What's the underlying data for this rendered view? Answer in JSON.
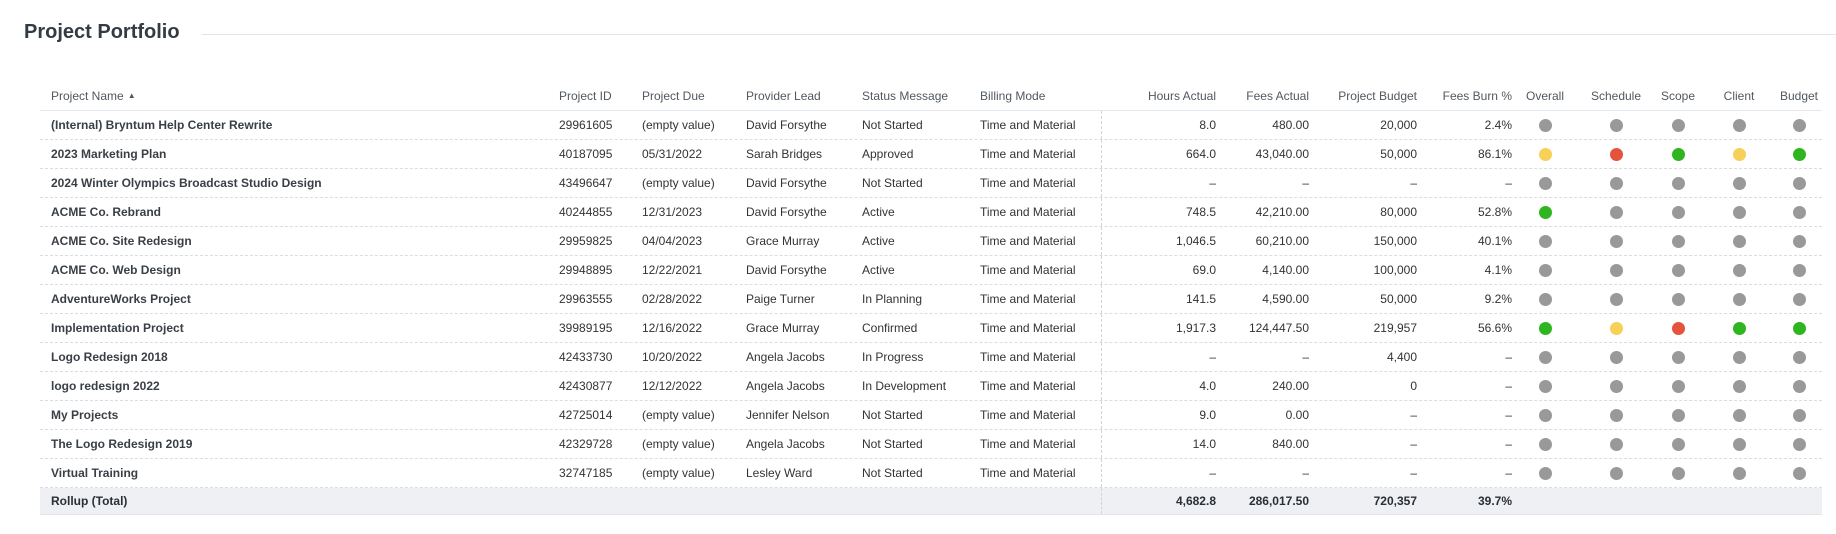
{
  "title": "Project Portfolio",
  "colors": {
    "grey": "#999999",
    "yellow": "#f6d057",
    "red": "#e5533d",
    "green": "#2fb520"
  },
  "columns": [
    {
      "key": "name",
      "label": "Project Name",
      "sorted": "asc",
      "sort_icon": "▲"
    },
    {
      "key": "id",
      "label": "Project ID"
    },
    {
      "key": "due",
      "label": "Project Due"
    },
    {
      "key": "lead",
      "label": "Provider Lead"
    },
    {
      "key": "status",
      "label": "Status Message"
    },
    {
      "key": "billing",
      "label": "Billing Mode"
    },
    {
      "key": "hours",
      "label": "Hours Actual"
    },
    {
      "key": "fees",
      "label": "Fees Actual"
    },
    {
      "key": "budget",
      "label": "Project Budget"
    },
    {
      "key": "burn",
      "label": "Fees Burn %"
    },
    {
      "key": "overall",
      "label": "Overall"
    },
    {
      "key": "schedule",
      "label": "Schedule"
    },
    {
      "key": "scope",
      "label": "Scope"
    },
    {
      "key": "client",
      "label": "Client"
    },
    {
      "key": "budgetStatus",
      "label": "Budget"
    }
  ],
  "rows": [
    {
      "name": "(Internal) Bryntum Help Center Rewrite",
      "id": "29961605",
      "due": "(empty value)",
      "lead": "David Forsythe",
      "status": "Not Started",
      "billing": "Time and Material",
      "hours": "8.0",
      "fees": "480.00",
      "budget": "20,000",
      "burn": "2.4%",
      "overall": "grey",
      "schedule": "grey",
      "scope": "grey",
      "client": "grey",
      "budgetStatus": "grey"
    },
    {
      "name": "2023 Marketing Plan",
      "id": "40187095",
      "due": "05/31/2022",
      "lead": "Sarah Bridges",
      "status": "Approved",
      "billing": "Time and Material",
      "hours": "664.0",
      "fees": "43,040.00",
      "budget": "50,000",
      "burn": "86.1%",
      "overall": "yellow",
      "schedule": "red",
      "scope": "green",
      "client": "yellow",
      "budgetStatus": "green"
    },
    {
      "name": "2024 Winter Olympics Broadcast Studio Design",
      "id": "43496647",
      "due": "(empty value)",
      "lead": "David Forsythe",
      "status": "Not Started",
      "billing": "Time and Material",
      "hours": "–",
      "fees": "–",
      "budget": "–",
      "burn": "–",
      "overall": "grey",
      "schedule": "grey",
      "scope": "grey",
      "client": "grey",
      "budgetStatus": "grey"
    },
    {
      "name": "ACME Co. Rebrand",
      "id": "40244855",
      "due": "12/31/2023",
      "lead": "David Forsythe",
      "status": "Active",
      "billing": "Time and Material",
      "hours": "748.5",
      "fees": "42,210.00",
      "budget": "80,000",
      "burn": "52.8%",
      "overall": "green",
      "schedule": "grey",
      "scope": "grey",
      "client": "grey",
      "budgetStatus": "grey"
    },
    {
      "name": "ACME Co. Site Redesign",
      "id": "29959825",
      "due": "04/04/2023",
      "lead": "Grace Murray",
      "status": "Active",
      "billing": "Time and Material",
      "hours": "1,046.5",
      "fees": "60,210.00",
      "budget": "150,000",
      "burn": "40.1%",
      "overall": "grey",
      "schedule": "grey",
      "scope": "grey",
      "client": "grey",
      "budgetStatus": "grey"
    },
    {
      "name": "ACME Co. Web Design",
      "id": "29948895",
      "due": "12/22/2021",
      "lead": "David Forsythe",
      "status": "Active",
      "billing": "Time and Material",
      "hours": "69.0",
      "fees": "4,140.00",
      "budget": "100,000",
      "burn": "4.1%",
      "overall": "grey",
      "schedule": "grey",
      "scope": "grey",
      "client": "grey",
      "budgetStatus": "grey"
    },
    {
      "name": "AdventureWorks Project",
      "id": "29963555",
      "due": "02/28/2022",
      "lead": "Paige Turner",
      "status": "In Planning",
      "billing": "Time and Material",
      "hours": "141.5",
      "fees": "4,590.00",
      "budget": "50,000",
      "burn": "9.2%",
      "overall": "grey",
      "schedule": "grey",
      "scope": "grey",
      "client": "grey",
      "budgetStatus": "grey"
    },
    {
      "name": "Implementation Project",
      "id": "39989195",
      "due": "12/16/2022",
      "lead": "Grace Murray",
      "status": "Confirmed",
      "billing": "Time and Material",
      "hours": "1,917.3",
      "fees": "124,447.50",
      "budget": "219,957",
      "burn": "56.6%",
      "overall": "green",
      "schedule": "yellow",
      "scope": "red",
      "client": "green",
      "budgetStatus": "green"
    },
    {
      "name": "Logo Redesign 2018",
      "id": "42433730",
      "due": "10/20/2022",
      "lead": "Angela Jacobs",
      "status": "In Progress",
      "billing": "Time and Material",
      "hours": "–",
      "fees": "–",
      "budget": "4,400",
      "burn": "–",
      "overall": "grey",
      "schedule": "grey",
      "scope": "grey",
      "client": "grey",
      "budgetStatus": "grey"
    },
    {
      "name": "logo redesign 2022",
      "id": "42430877",
      "due": "12/12/2022",
      "lead": "Angela Jacobs",
      "status": "In Development",
      "billing": "Time and Material",
      "hours": "4.0",
      "fees": "240.00",
      "budget": "0",
      "burn": "–",
      "overall": "grey",
      "schedule": "grey",
      "scope": "grey",
      "client": "grey",
      "budgetStatus": "grey"
    },
    {
      "name": "My Projects",
      "id": "42725014",
      "due": "(empty value)",
      "lead": "Jennifer Nelson",
      "status": "Not Started",
      "billing": "Time and Material",
      "hours": "9.0",
      "fees": "0.00",
      "budget": "–",
      "burn": "–",
      "overall": "grey",
      "schedule": "grey",
      "scope": "grey",
      "client": "grey",
      "budgetStatus": "grey"
    },
    {
      "name": "The Logo Redesign 2019",
      "id": "42329728",
      "due": "(empty value)",
      "lead": "Angela Jacobs",
      "status": "Not Started",
      "billing": "Time and Material",
      "hours": "14.0",
      "fees": "840.00",
      "budget": "–",
      "burn": "–",
      "overall": "grey",
      "schedule": "grey",
      "scope": "grey",
      "client": "grey",
      "budgetStatus": "grey"
    },
    {
      "name": "Virtual Training",
      "id": "32747185",
      "due": "(empty value)",
      "lead": "Lesley Ward",
      "status": "Not Started",
      "billing": "Time and Material",
      "hours": "–",
      "fees": "–",
      "budget": "–",
      "burn": "–",
      "overall": "grey",
      "schedule": "grey",
      "scope": "grey",
      "client": "grey",
      "budgetStatus": "grey"
    }
  ],
  "total": {
    "name": "Rollup (Total)",
    "hours": "4,682.8",
    "fees": "286,017.50",
    "budget": "720,357",
    "burn": "39.7%"
  }
}
